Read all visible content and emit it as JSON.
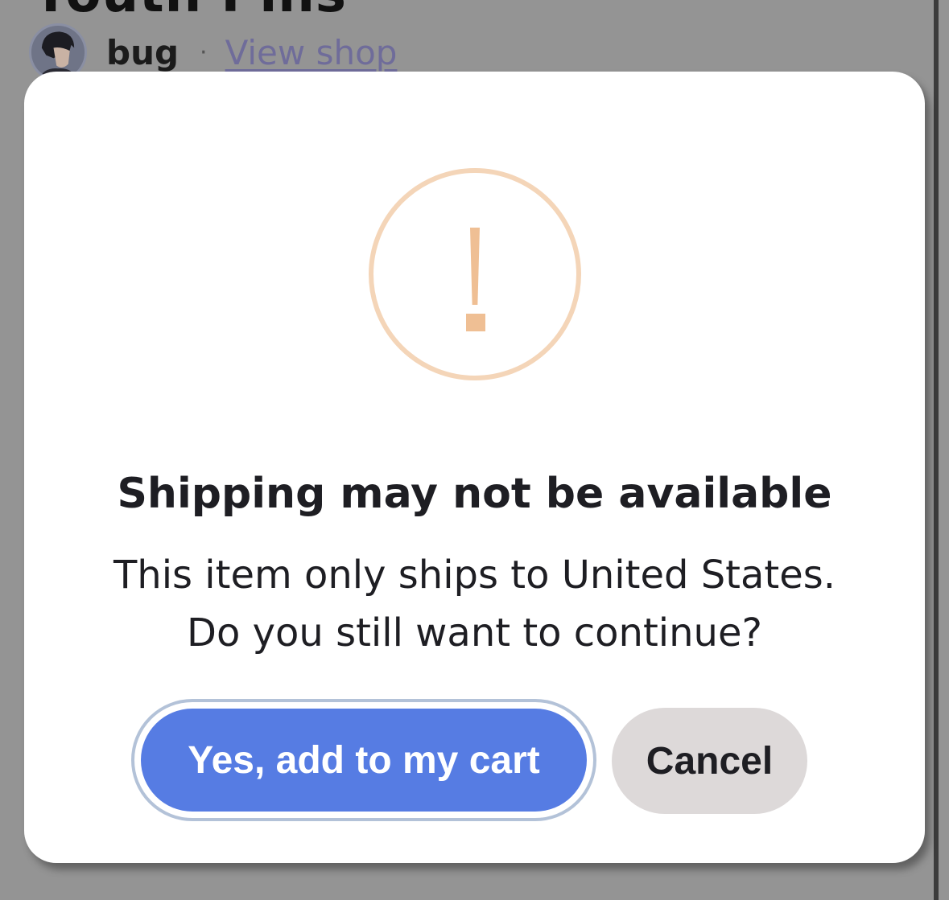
{
  "background": {
    "title": "Youth Pins",
    "seller": {
      "name": "bug",
      "separator": "·",
      "view_shop_label": "View shop"
    }
  },
  "dialog": {
    "icon": "exclamation-circle-icon",
    "title": "Shipping may not be available",
    "message_line1": "This item only ships to United States.",
    "message_line2": "Do you still want to continue?",
    "confirm_label": "Yes, add to my cart",
    "cancel_label": "Cancel"
  },
  "colors": {
    "confirm": "#567ce3",
    "cancel": "#ddd9d9",
    "warning": "#efbf94",
    "overlay": "#949494"
  }
}
